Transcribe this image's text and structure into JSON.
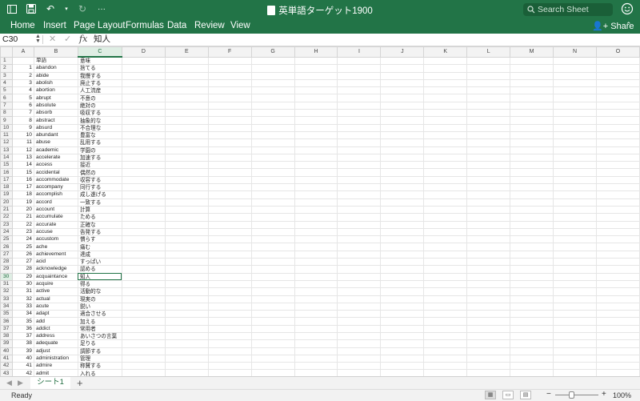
{
  "window": {
    "title": "英単語ターゲット1900"
  },
  "titlebar": {
    "search_placeholder": "Search Sheet"
  },
  "ribbon": {
    "tabs": [
      "Home",
      "Insert",
      "Page Layout",
      "Formulas",
      "Data",
      "Review",
      "View"
    ],
    "share_label": "Share"
  },
  "formula_bar": {
    "cell_ref": "C30",
    "fx_label": "fx",
    "value": "知人"
  },
  "columns": [
    "A",
    "B",
    "C",
    "D",
    "E",
    "F",
    "G",
    "H",
    "I",
    "J",
    "K",
    "L",
    "M",
    "N",
    "O"
  ],
  "selected": {
    "row": 30,
    "column": "C"
  },
  "rows": [
    [
      "1",
      "",
      "単語",
      "意味"
    ],
    [
      "2",
      "1",
      "abandon",
      "捨てる"
    ],
    [
      "3",
      "2",
      "abide",
      "我慢する"
    ],
    [
      "4",
      "3",
      "abolish",
      "廃止する"
    ],
    [
      "5",
      "4",
      "abortion",
      "人工流産"
    ],
    [
      "6",
      "5",
      "abrupt",
      "不意の"
    ],
    [
      "7",
      "6",
      "absolute",
      "絶対の"
    ],
    [
      "8",
      "7",
      "absorb",
      "吸収する"
    ],
    [
      "9",
      "8",
      "abstract",
      "抽象的な"
    ],
    [
      "10",
      "9",
      "absurd",
      "不合理な"
    ],
    [
      "11",
      "10",
      "abundant",
      "豊富な"
    ],
    [
      "12",
      "11",
      "abuse",
      "乱用する"
    ],
    [
      "13",
      "12",
      "academic",
      "学園の"
    ],
    [
      "14",
      "13",
      "accelerate",
      "加速する"
    ],
    [
      "15",
      "14",
      "access",
      "接近"
    ],
    [
      "16",
      "15",
      "accidental",
      "偶然の"
    ],
    [
      "17",
      "16",
      "accommodate",
      "収容する"
    ],
    [
      "18",
      "17",
      "accompany",
      "同行する"
    ],
    [
      "19",
      "18",
      "accomplish",
      "成し遂げる"
    ],
    [
      "20",
      "19",
      "accord",
      "一致する"
    ],
    [
      "21",
      "20",
      "account",
      "計算"
    ],
    [
      "22",
      "21",
      "accumulate",
      "ためる"
    ],
    [
      "23",
      "22",
      "accurate",
      "正確な"
    ],
    [
      "24",
      "23",
      "accuse",
      "告発する"
    ],
    [
      "25",
      "24",
      "accustom",
      "慣らす"
    ],
    [
      "26",
      "25",
      "ache",
      "痛む"
    ],
    [
      "27",
      "26",
      "achievement",
      "達成"
    ],
    [
      "28",
      "27",
      "acid",
      "すっぱい"
    ],
    [
      "29",
      "28",
      "acknowledge",
      "認める"
    ],
    [
      "30",
      "29",
      "acquaintance",
      "知人"
    ],
    [
      "31",
      "30",
      "acquire",
      "得る"
    ],
    [
      "32",
      "31",
      "active",
      "活動的な"
    ],
    [
      "33",
      "32",
      "actual",
      "現実の"
    ],
    [
      "34",
      "33",
      "acute",
      "鋭い"
    ],
    [
      "35",
      "34",
      "adapt",
      "適合させる"
    ],
    [
      "36",
      "35",
      "add",
      "加える"
    ],
    [
      "37",
      "36",
      "addict",
      "常用者"
    ],
    [
      "38",
      "37",
      "address",
      "あいさつの言葉"
    ],
    [
      "39",
      "38",
      "adequate",
      "足りる"
    ],
    [
      "40",
      "39",
      "adjust",
      "調節する"
    ],
    [
      "41",
      "40",
      "administration",
      "管理"
    ],
    [
      "42",
      "41",
      "admire",
      "称賛する"
    ],
    [
      "43",
      "42",
      "admit",
      "入れる"
    ]
  ],
  "sheet_tabs": [
    {
      "label": "シート1",
      "active": true
    }
  ],
  "status": {
    "text": "Ready",
    "zoom": "100%"
  },
  "colors": {
    "accent": "#227447",
    "accent_dark": "#1a5f38",
    "grid": "#e6e6e6"
  }
}
